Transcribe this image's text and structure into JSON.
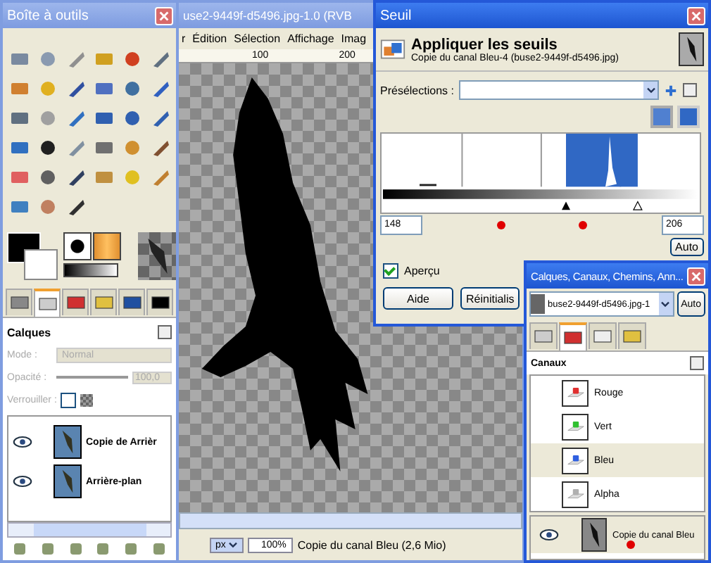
{
  "toolbox": {
    "title": "Boîte à outils",
    "dock_tabs": [
      {
        "selected": false
      },
      {
        "selected": true
      },
      {
        "selected": false
      },
      {
        "selected": false
      },
      {
        "selected": false
      },
      {
        "selected": false
      }
    ],
    "layers_panel": {
      "title": "Calques",
      "mode_label": "Mode :",
      "mode_value": "Normal",
      "opacity_label": "Opacité :",
      "opacity_value": "100,0",
      "level": 1,
      "disabled": true,
      "lock": {
        "label": "Verrouiller :",
        "checked": false
      },
      "layers": [
        {
          "name": "Copie de Arrièr",
          "visible": true
        },
        {
          "name": "Arrière-plan",
          "visible": true
        }
      ]
    }
  },
  "image_window": {
    "title": "use2-9449f-d5496.jpg-1.0 (RVB",
    "menus": [
      "r",
      "Édition",
      "Sélection",
      "Affichage",
      "Imag"
    ],
    "ruler_ticks": [
      "100",
      "200"
    ],
    "unit": "px",
    "zoom": "100%",
    "status": "Copie du canal Bleu (2,6 Mio)"
  },
  "threshold_dialog": {
    "title": "Seuil",
    "heading": "Appliquer les seuils",
    "subtitle": "Copie du canal Bleu-4 (buse2-9449f-d5496.jpg)",
    "presets_label": "Présélections :",
    "low": "148",
    "high": "206",
    "auto": "Auto",
    "preview": {
      "label": "Aperçu",
      "checked": true
    },
    "buttons": [
      "Aide",
      "Réinitialis"
    ]
  },
  "docks_window": {
    "title": "Calques, Canaux, Chemins, Ann...",
    "image": "buse2-9449f-d5496.jpg-1",
    "auto": "Auto",
    "tabs": [
      {
        "selected": false
      },
      {
        "selected": true
      },
      {
        "selected": false
      },
      {
        "selected": false
      }
    ],
    "panel_title": "Canaux",
    "channels": [
      {
        "name": "Rouge",
        "color": "#e03030",
        "selected": false
      },
      {
        "name": "Vert",
        "color": "#30c030",
        "selected": false
      },
      {
        "name": "Bleu",
        "color": "#3060e0",
        "selected": true
      },
      {
        "name": "Alpha",
        "color": "#b0b0b0",
        "selected": false
      }
    ],
    "saved_channels": [
      {
        "name": "Copie du canal Bleu",
        "visible": true
      }
    ]
  }
}
